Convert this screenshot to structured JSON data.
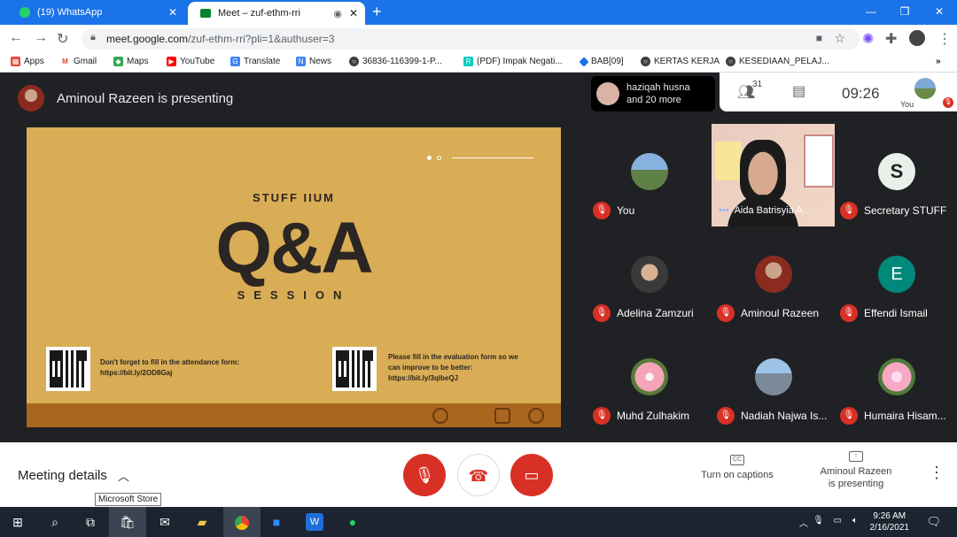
{
  "browser": {
    "tabs": [
      {
        "label": "(19) WhatsApp",
        "icon": "whatsapp-icon",
        "active": false
      },
      {
        "label": "Meet – zuf-ethm-rri",
        "icon": "meet-icon",
        "active": true
      }
    ],
    "url_host": "meet.google.com",
    "url_rest": "/zuf-ethm-rri?pli=1&authuser=3",
    "bookmarks": [
      {
        "label": "Apps",
        "icon": "apps-grid-icon"
      },
      {
        "label": "Gmail",
        "icon": "gmail-icon"
      },
      {
        "label": "Maps",
        "icon": "maps-icon"
      },
      {
        "label": "YouTube",
        "icon": "youtube-icon"
      },
      {
        "label": "Translate",
        "icon": "translate-icon"
      },
      {
        "label": "News",
        "icon": "news-icon"
      },
      {
        "label": "36836-116399-1-P...",
        "icon": "globe-icon"
      },
      {
        "label": "(PDF) Impak Negati...",
        "icon": "researchgate-icon"
      },
      {
        "label": "BAB[09]",
        "icon": "diamond-icon"
      },
      {
        "label": "KERTAS KERJA",
        "icon": "globe-icon"
      },
      {
        "label": "KESEDIAAN_PELAJ...",
        "icon": "globe-icon"
      }
    ]
  },
  "meet": {
    "presenter_banner": "Aminoul Razeen is presenting",
    "people_card": {
      "line1": "haziqah husna",
      "line2": "and 20 more"
    },
    "participant_count": "31",
    "clock": "09:26",
    "self_label": "You",
    "slide": {
      "org": "STUFF IIUM",
      "title": "Q&A",
      "subtitle": "SESSION",
      "note_left_1": "Don't forget to fill in the attendance form:",
      "note_left_2": "https://bit.ly/2OD8Gaj",
      "note_right_1": "Please fill in the evaluation form so we",
      "note_right_2": "can improve to be better:",
      "note_right_3": "https://bit.ly/3qlbeQJ"
    },
    "participants": [
      {
        "name": "You",
        "avatar": "landscape"
      },
      {
        "name": "Aida Batrisyia A...",
        "avatar": "video"
      },
      {
        "name": "Secretary STUFF",
        "avatar": "S"
      },
      {
        "name": "Adelina Zamzuri",
        "avatar": "photo"
      },
      {
        "name": "Aminoul Razeen",
        "avatar": "photo"
      },
      {
        "name": "Effendi Ismail",
        "avatar": "E"
      },
      {
        "name": "Muhd Zulhakim",
        "avatar": "flower"
      },
      {
        "name": "Nadiah Najwa Is...",
        "avatar": "city"
      },
      {
        "name": "Humaira Hisam...",
        "avatar": "flower"
      }
    ],
    "bottom": {
      "meeting_details": "Meeting details",
      "captions": "Turn on captions",
      "presenting_1": "Aminoul Razeen",
      "presenting_2": "is presenting"
    },
    "tooltip": "Microsoft Store"
  },
  "taskbar": {
    "time": "9:26 AM",
    "date": "2/16/2021"
  },
  "colors": {
    "chrome_blue": "#1a73e8",
    "meet_bg": "#202124",
    "mute_red": "#d93025",
    "slide_gold": "#d9ad55"
  }
}
